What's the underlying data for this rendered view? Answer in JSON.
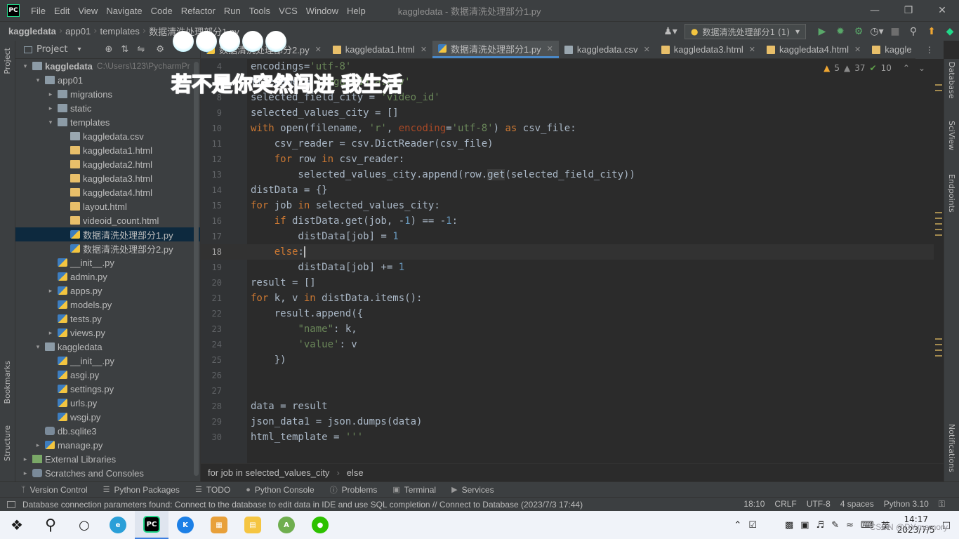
{
  "menubar": {
    "logo": "PC",
    "items": [
      "File",
      "Edit",
      "View",
      "Navigate",
      "Code",
      "Refactor",
      "Run",
      "Tools",
      "VCS",
      "Window",
      "Help"
    ],
    "title": "kaggledata - 数据清洗处理部分1.py"
  },
  "navbar": {
    "crumbs": [
      "kaggledata",
      "app01",
      "templates",
      "数据清洗处理部分1.py"
    ],
    "run_config": "数据清洗处理部分1 (1)"
  },
  "project_panel": {
    "title": "Project",
    "tree": [
      {
        "label": "kaggledata",
        "path": "C:\\Users\\123\\PycharmPr",
        "depth": 0,
        "arrow": "▾",
        "icon": "folder",
        "bold": true
      },
      {
        "label": "app01",
        "depth": 1,
        "arrow": "▾",
        "icon": "folder"
      },
      {
        "label": "migrations",
        "depth": 2,
        "arrow": "▸",
        "icon": "folder"
      },
      {
        "label": "static",
        "depth": 2,
        "arrow": "▸",
        "icon": "folder"
      },
      {
        "label": "templates",
        "depth": 2,
        "arrow": "▾",
        "icon": "folder"
      },
      {
        "label": "kaggledata.csv",
        "depth": 3,
        "arrow": "",
        "icon": "csv"
      },
      {
        "label": "kaggledata1.html",
        "depth": 3,
        "arrow": "",
        "icon": "html"
      },
      {
        "label": "kaggledata2.html",
        "depth": 3,
        "arrow": "",
        "icon": "html"
      },
      {
        "label": "kaggledata3.html",
        "depth": 3,
        "arrow": "",
        "icon": "html"
      },
      {
        "label": "kaggledata4.html",
        "depth": 3,
        "arrow": "",
        "icon": "html"
      },
      {
        "label": "layout.html",
        "depth": 3,
        "arrow": "",
        "icon": "html"
      },
      {
        "label": "videoid_count.html",
        "depth": 3,
        "arrow": "",
        "icon": "html"
      },
      {
        "label": "数据清洗处理部分1.py",
        "depth": 3,
        "arrow": "",
        "icon": "py",
        "selected": true
      },
      {
        "label": "数据清洗处理部分2.py",
        "depth": 3,
        "arrow": "",
        "icon": "py"
      },
      {
        "label": "__init__.py",
        "depth": 2,
        "arrow": "",
        "icon": "py"
      },
      {
        "label": "admin.py",
        "depth": 2,
        "arrow": "",
        "icon": "py"
      },
      {
        "label": "apps.py",
        "depth": 2,
        "arrow": "▸",
        "icon": "py"
      },
      {
        "label": "models.py",
        "depth": 2,
        "arrow": "",
        "icon": "py"
      },
      {
        "label": "tests.py",
        "depth": 2,
        "arrow": "",
        "icon": "py"
      },
      {
        "label": "views.py",
        "depth": 2,
        "arrow": "▸",
        "icon": "py"
      },
      {
        "label": "kaggledata",
        "depth": 1,
        "arrow": "▾",
        "icon": "folder"
      },
      {
        "label": "__init__.py",
        "depth": 2,
        "arrow": "",
        "icon": "py"
      },
      {
        "label": "asgi.py",
        "depth": 2,
        "arrow": "",
        "icon": "py"
      },
      {
        "label": "settings.py",
        "depth": 2,
        "arrow": "",
        "icon": "py"
      },
      {
        "label": "urls.py",
        "depth": 2,
        "arrow": "",
        "icon": "py"
      },
      {
        "label": "wsgi.py",
        "depth": 2,
        "arrow": "",
        "icon": "py"
      },
      {
        "label": "db.sqlite3",
        "depth": 1,
        "arrow": "",
        "icon": "db"
      },
      {
        "label": "manage.py",
        "depth": 1,
        "arrow": "▸",
        "icon": "py"
      },
      {
        "label": "External Libraries",
        "depth": 0,
        "arrow": "▸",
        "icon": "lib"
      },
      {
        "label": "Scratches and Consoles",
        "depth": 0,
        "arrow": "▸",
        "icon": "db"
      }
    ]
  },
  "tabs": [
    {
      "label": "数据清洗处理部分2.py",
      "icon": "py"
    },
    {
      "label": "kaggledata1.html",
      "icon": "html"
    },
    {
      "label": "数据清洗处理部分1.py",
      "icon": "py",
      "active": true
    },
    {
      "label": "kaggledata.csv",
      "icon": "csv"
    },
    {
      "label": "kaggledata3.html",
      "icon": "html"
    },
    {
      "label": "kaggledata4.html",
      "icon": "html"
    },
    {
      "label": "kaggle",
      "icon": "html"
    }
  ],
  "inspections": {
    "warnings": "5",
    "weak": "37",
    "ok": "10"
  },
  "code_lines": [
    {
      "n": "4",
      "html": "encodings=<span class='str'>'utf-8'</span>"
    },
    {
      "n": "7",
      "html": "filename = <span class='str'>'kaggledata.csv'</span>"
    },
    {
      "n": "8",
      "html": "selected_field_city = <span class='str'>'video_id'</span>"
    },
    {
      "n": "9",
      "html": "selected_values_city = []"
    },
    {
      "n": "10",
      "html": "<span class='kw'>with</span> open(filename, <span class='str'>'r'</span>, <span class='param'>encoding</span>=<span class='str'>'utf-8'</span>) <span class='kw'>as</span> csv_file:"
    },
    {
      "n": "11",
      "html": "    csv_reader = csv.DictReader(csv_file)"
    },
    {
      "n": "12",
      "html": "    <span class='kw'>for</span> row <span class='kw'>in</span> csv_reader:"
    },
    {
      "n": "13",
      "html": "        selected_values_city.append(row.<span class='hl'>get</span>(selected_field_city))"
    },
    {
      "n": "14",
      "html": "distData = {}"
    },
    {
      "n": "15",
      "html": "<span class='kw'>for</span> job <span class='kw'>in</span> selected_values_city:"
    },
    {
      "n": "16",
      "html": "    <span class='kw'>if</span> distData.get(job, -<span style='color:#6897bb'>1</span>) == -<span style='color:#6897bb'>1</span>:"
    },
    {
      "n": "17",
      "html": "        distData[job] = <span style='color:#6897bb'>1</span>"
    },
    {
      "n": "18",
      "html": "    <span class='kw'>else</span>:<span class='caret'></span>",
      "current": true
    },
    {
      "n": "19",
      "html": "        distData[job] += <span style='color:#6897bb'>1</span>"
    },
    {
      "n": "20",
      "html": "result = []"
    },
    {
      "n": "21",
      "html": "<span class='kw'>for</span> k, v <span class='kw'>in</span> distData.items():"
    },
    {
      "n": "22",
      "html": "    result.append({"
    },
    {
      "n": "23",
      "html": "        <span class='str'>\"name\"</span>: k,"
    },
    {
      "n": "24",
      "html": "        <span class='str'>'value'</span>: v"
    },
    {
      "n": "25",
      "html": "    })"
    },
    {
      "n": "26",
      "html": ""
    },
    {
      "n": "27",
      "html": ""
    },
    {
      "n": "28",
      "html": "data = result"
    },
    {
      "n": "29",
      "html": "json_data1 = json.dumps(data)"
    },
    {
      "n": "30",
      "html": "html_template = <span class='str'>'''</span>"
    }
  ],
  "code_breadcrumb": [
    "for job in selected_values_city",
    "else"
  ],
  "left_stripe": [
    "Project",
    "Bookmarks",
    "Structure"
  ],
  "right_stripe": [
    "Database",
    "SciView",
    "Endpoints",
    "Notifications"
  ],
  "tool_windows": [
    "Version Control",
    "Python Packages",
    "TODO",
    "Python Console",
    "Problems",
    "Terminal",
    "Services"
  ],
  "status": {
    "message": "Database connection parameters found: Connect to the database to edit data in IDE and use SQL completion // Connect to Database (2023/7/3 17:44)",
    "position": "18:10",
    "line_sep": "CRLF",
    "encoding": "UTF-8",
    "indent": "4 spaces",
    "interpreter": "Python 3.10"
  },
  "taskbar": {
    "time": "14:17",
    "date": "2023/7/5",
    "ime": "英",
    "watermark": "CSDN @DY.memory"
  },
  "overlay": {
    "subtitle": "若不是你突然闯进 我生活"
  }
}
